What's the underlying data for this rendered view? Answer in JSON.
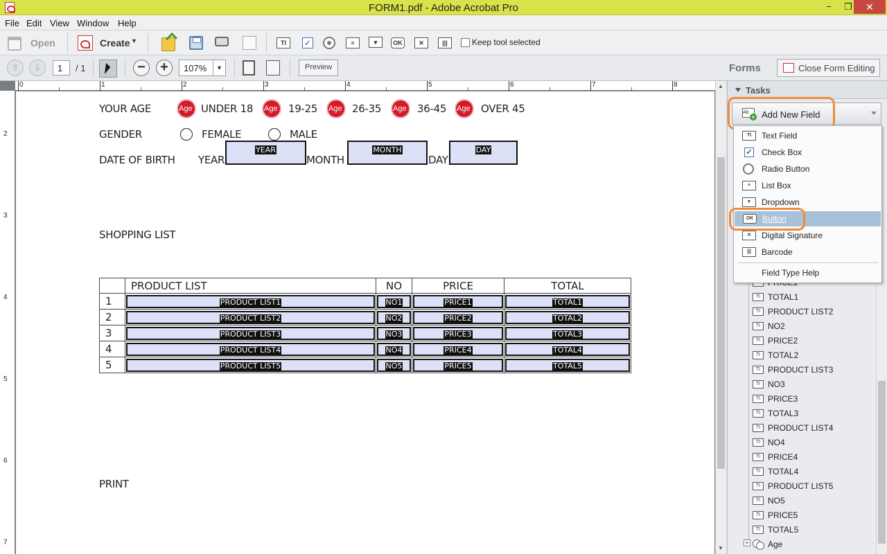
{
  "window": {
    "title": "FORM1.pdf - Adobe Acrobat Pro",
    "minimize": "−",
    "maximize": "❐",
    "close": "✕"
  },
  "menu": [
    "File",
    "Edit",
    "View",
    "Window",
    "Help"
  ],
  "toolbar": {
    "open_label": "Open",
    "create_label": "Create",
    "keep_tool_label": "Keep tool selected",
    "keep_tool_checked": false
  },
  "nav": {
    "page_current": "1",
    "page_total": "/ 1",
    "zoom": "107%",
    "preview_label": "Preview"
  },
  "forms_panel": {
    "forms_label": "Forms",
    "close_form_editing_label": "Close Form Editing",
    "tasks_label": "Tasks",
    "add_new_field_label": "Add New Field",
    "field_types": [
      {
        "label": "Text Field",
        "icon": "text-field-icon",
        "selected": false
      },
      {
        "label": "Check Box",
        "icon": "check-box-icon",
        "selected": false
      },
      {
        "label": "Radio Button",
        "icon": "radio-button-icon",
        "selected": false
      },
      {
        "label": "List Box",
        "icon": "list-box-icon",
        "selected": false
      },
      {
        "label": "Dropdown",
        "icon": "dropdown-icon",
        "selected": false
      },
      {
        "label": "Button",
        "icon": "button-icon",
        "selected": true
      },
      {
        "label": "Digital Signature",
        "icon": "signature-icon",
        "selected": false
      },
      {
        "label": "Barcode",
        "icon": "barcode-icon",
        "selected": false
      }
    ],
    "field_type_help_label": "Field Type Help",
    "fields_tree": [
      "PRICE1",
      "TOTAL1",
      "PRODUCT LIST2",
      "NO2",
      "PRICE2",
      "TOTAL2",
      "PRODUCT LIST3",
      "NO3",
      "PRICE3",
      "TOTAL3",
      "PRODUCT LIST4",
      "NO4",
      "PRICE4",
      "TOTAL4",
      "PRODUCT LIST5",
      "NO5",
      "PRICE5",
      "TOTAL5",
      "Age"
    ]
  },
  "ruler": {
    "top_ticks": [
      "0",
      "1",
      "2",
      "3",
      "4",
      "5",
      "6",
      "7",
      "8"
    ],
    "left_ticks": [
      "2",
      "3",
      "4",
      "5",
      "6",
      "7"
    ]
  },
  "document": {
    "age_label": "YOUR AGE",
    "age_options": [
      "UNDER 18",
      "19-25",
      "26-35",
      "36-45",
      "OVER 45"
    ],
    "age_field_name": "Age",
    "gender_label": "GENDER",
    "gender_options": [
      "FEMALE",
      "MALE"
    ],
    "dob_label": "DATE OF BIRTH",
    "dob_year_label": "YEAR",
    "dob_month_label": "MONTH",
    "dob_day_label": "DAY",
    "dob_fields": [
      "YEAR",
      "MONTH",
      "DAY"
    ],
    "shopping_list_label": "SHOPPING LIST",
    "table_headers": [
      "PRODUCT LIST",
      "NO",
      "PRICE",
      "TOTAL"
    ],
    "table_rows": [
      {
        "num": "1",
        "product": "PRODUCT LIST1",
        "no": "NO1",
        "price": "PRICE1",
        "total": "TOTAL1"
      },
      {
        "num": "2",
        "product": "PRODUCT LIST2",
        "no": "NO2",
        "price": "PRICE2",
        "total": "TOTAL2"
      },
      {
        "num": "3",
        "product": "PRODUCT LIST3",
        "no": "NO3",
        "price": "PRICE3",
        "total": "TOTAL3"
      },
      {
        "num": "4",
        "product": "PRODUCT LIST4",
        "no": "NO4",
        "price": "PRICE4",
        "total": "TOTAL4"
      },
      {
        "num": "5",
        "product": "PRODUCT LIST5",
        "no": "NO5",
        "price": "PRICE5",
        "total": "TOTAL5"
      }
    ],
    "print_label": "PRINT"
  },
  "colors": {
    "title_bar": "#d8e34a",
    "field_fill": "#dce1f8",
    "age_radio": "#d41b2a",
    "highlight": "#ef8a3a",
    "selected_item": "#a9c1d8"
  }
}
